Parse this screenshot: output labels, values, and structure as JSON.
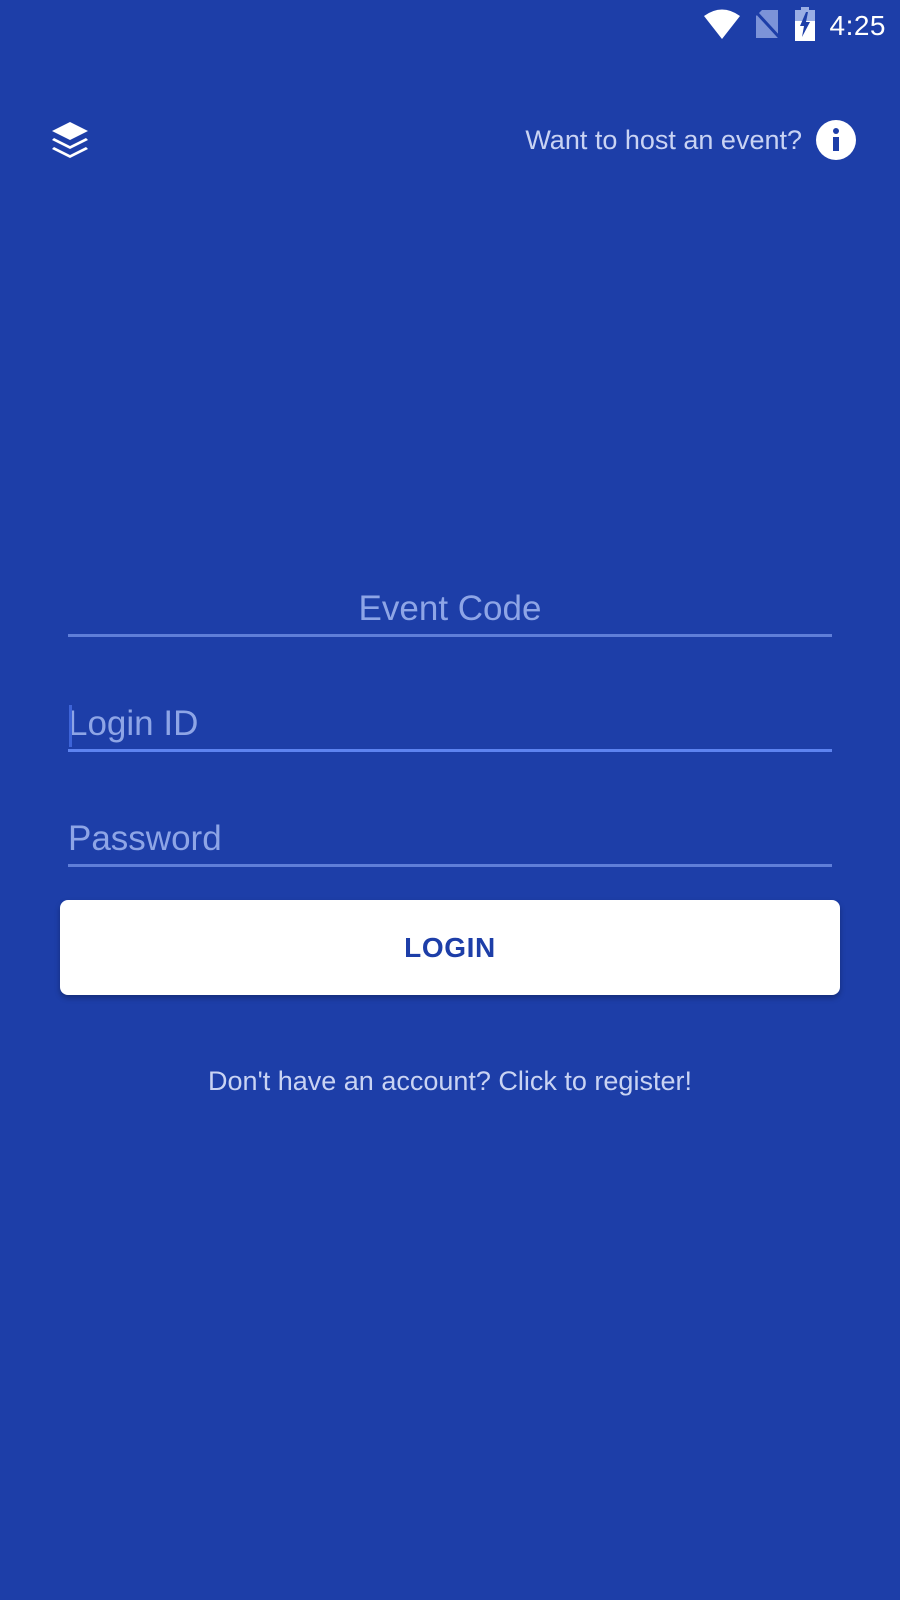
{
  "status_bar": {
    "time": "4:25",
    "icons": [
      "wifi-icon",
      "no-sim-icon",
      "battery-charging-icon"
    ]
  },
  "header": {
    "logo_icon": "layers-icon",
    "host_prompt": "Want to host an event?",
    "info_icon": "info-icon"
  },
  "form": {
    "event_code": {
      "placeholder": "Event Code",
      "value": ""
    },
    "login_id": {
      "placeholder": "Login ID",
      "value": ""
    },
    "password": {
      "placeholder": "Password",
      "value": ""
    },
    "login_label": "LOGIN",
    "register_prompt": "Don't have an account? Click to register!"
  },
  "colors": {
    "background": "#1d3ea8",
    "button": "#ffffff",
    "button_text": "#1d3ea8",
    "underline": "#5f7ed8",
    "focused_underline": "#5d83f0",
    "secondary_text": "#c9d3f3"
  }
}
